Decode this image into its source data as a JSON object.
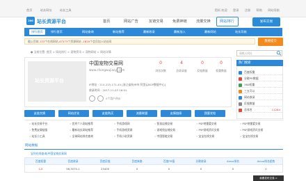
{
  "top": {
    "links_left": [
      "首页",
      "站长网址",
      "站长工具"
    ],
    "links_right": [
      "您好,欢迎",
      "登录",
      "注册",
      "帮助",
      "网站导航"
    ]
  },
  "header": {
    "logo_mark": "200",
    "logo_text": "站长资源平台",
    "nav": [
      "首页",
      "网站广告",
      "友链交易",
      "免费神链",
      "流量交换",
      "网站排行"
    ],
    "active_nav": "网站排行",
    "cta": "发布交易"
  },
  "subnav": [
    "排行首页",
    "排行首页",
    "网站查询",
    "新站推荐",
    "最新收录",
    "最新加入",
    "最新网站",
    "站长导航"
  ],
  "notice": {
    "prefix": "截止目前,",
    "count1": "133",
    "mid1": "个在线网站,",
    "count2": "47573",
    "mid2": "个资源网站 ,",
    "count3": "1820",
    "suffix": "个会员加入站长网",
    "button": "我要提交"
  },
  "breadcrumb": "● 当前位置: 首页 > 网站排行 > 宠物资讯 > 宠物网站 > 网站详情",
  "search_placeholder": "请输入网址",
  "site": {
    "thumb_text": "站长资源平台",
    "title": "中国宠物交易网",
    "url": "www.chongwujiaoyi.com",
    "stats": [
      {
        "num": "0",
        "label": "浏览次数"
      },
      {
        "num": "4",
        "label": "总收录量"
      },
      {
        "num": "0",
        "label": "反链数量"
      },
      {
        "num": "0",
        "label": "权重数量"
      }
    ],
    "info": [
      "IP地址 :  114.215.171.45  [浙江省杭州市 阿里云BGP数据中心]",
      "收录时间 :  2017-11-03 16:01"
    ],
    "votes": "0个用户评价"
  },
  "sidebar": {
    "title": "热门搜索",
    "rows": [
      {
        "label": "百度权重",
        "num": "",
        "color": "#2d89d8"
      },
      {
        "label": "谷歌PR数据",
        "num": "",
        "color": "#e04a3a"
      },
      {
        "label": "360权重",
        "num": "",
        "color": "#3aa35a"
      },
      {
        "label": "三五可以",
        "num": "",
        "color": "#f28a1c"
      },
      {
        "label": "网站收录",
        "num": "",
        "color": "#2d89d8"
      },
      {
        "label": "反链数量",
        "num": "",
        "color": "#888888"
      },
      {
        "label": "总排名",
        "num": "11264",
        "color": "#e04a3a"
      }
    ]
  },
  "buttons": [
    "友链交换",
    "网站优化",
    "友链购买",
    "流量联盟",
    "友情链接",
    "我要发帖"
  ],
  "categories": [
    [
      "站长交易平台",
      "优秀个人网站推荐",
      "手机游戏网",
      "智慧店铺交易",
      "PSP地雷爱交易",
      "PSP地雷爱交易"
    ],
    [
      "免费友情链接",
      "最新站长网站推荐",
      "手机游戏资源",
      "游戏找店铺交易",
      "PSP游戏资讯交易",
      "PSP游戏资讯交易"
    ],
    [
      "站长小工具",
      "全球网站排名查询",
      "手机小说资源",
      "中国智能交易",
      "宝宝在线交易",
      "宝宝在线交易"
    ]
  ],
  "section": {
    "tab": "网站数据",
    "subrow": "宝利在线查询|中国宝物交易网"
  },
  "table": {
    "headers": [
      "百度权重",
      "百度收录",
      "百度反链",
      "百度来路",
      "百度PR值",
      "谷歌收录",
      "Alexa排名",
      "Alexa排名趋势"
    ],
    "row": [
      "4-8",
      "56,3070-1",
      "23400",
      "0",
      "0",
      "0",
      "0",
      "0"
    ]
  },
  "corner_chip": "我要发布交易 >"
}
